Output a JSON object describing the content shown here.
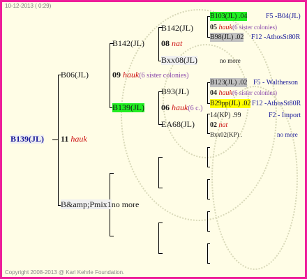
{
  "header": {
    "date": "10-12-2013 ( 0:29)"
  },
  "footer": {
    "copyright": "Copyright 2008-2013 @ Karl Kehrle Foundation."
  },
  "subject": {
    "id": "B139(JL)"
  },
  "gen1": {
    "top": {
      "id": "B06(JL)"
    },
    "mid": {
      "num": "11",
      "name": "hauk"
    },
    "bottom": {
      "id": "B&amp;Pmix1",
      "more": "no more"
    }
  },
  "gen2": {
    "top": {
      "id": "B142(JL)",
      "num": "09",
      "name": "hauk",
      "note": "(6 sister colonies)"
    },
    "bottom": {
      "id": "B139(JL)",
      "num": "06",
      "name": "hauk",
      "note": "(6 c.)"
    }
  },
  "gen3": {
    "a": {
      "id": "B142(JL)",
      "num": "08",
      "name": "nat"
    },
    "b": {
      "id": "Bxx08(JL)",
      "more": "no more"
    },
    "c": {
      "id": "B93(JL)",
      "num": "04",
      "name": "hauk",
      "note": "(6 sister colonies)"
    },
    "d": {
      "id": "EA68(JL)",
      "num": "02",
      "name": "nat"
    }
  },
  "gen4": {
    "a1": {
      "id": "B103(JL) .04",
      "ref": "F5 -B04(JL)"
    },
    "a1n": {
      "num": "05",
      "name": "hauk",
      "note": "(6 sister colonies)"
    },
    "a2": {
      "id": "B98(JL) .02",
      "ref": "F12 -AthosSt80R"
    },
    "b1": {
      "more": "no more"
    },
    "c1": {
      "id": "B123(JL) .02",
      "ref": "F5 - Waltherson"
    },
    "c2": {
      "id": "B29pp(JL) .02",
      "ref": "F12 -AthosSt80R"
    },
    "d1": {
      "id": "14(KP) .99",
      "ref": "F2 - Import"
    },
    "d2": {
      "id": "Bxx02(KP) .",
      "more": "no more"
    }
  }
}
